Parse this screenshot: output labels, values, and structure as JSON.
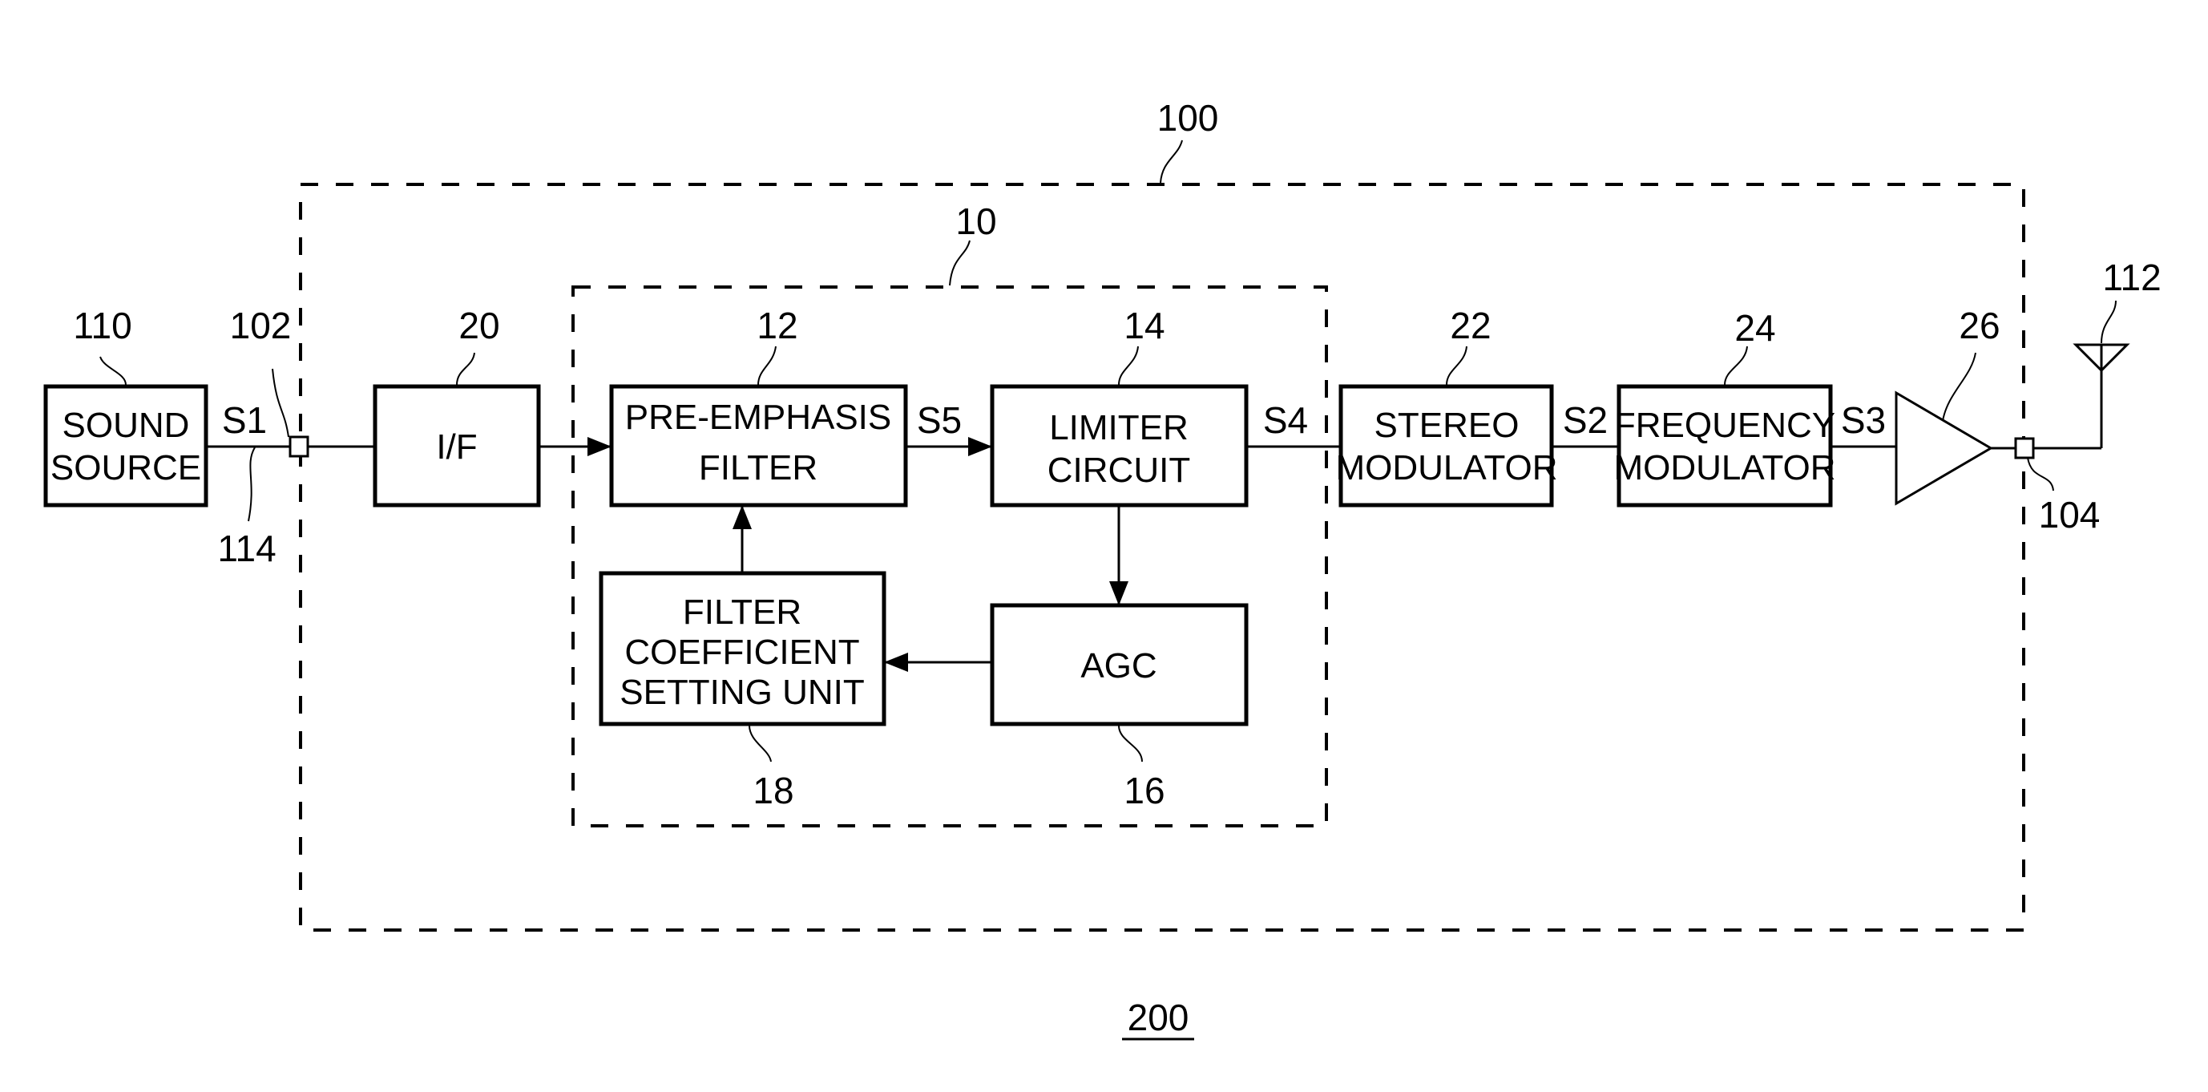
{
  "figure_label": "200",
  "groups": {
    "outer": {
      "ref": "100"
    },
    "inner": {
      "ref": "10"
    }
  },
  "blocks": {
    "sound_source": {
      "ref": "110",
      "lines": [
        "SOUND",
        "SOURCE"
      ]
    },
    "interface": {
      "ref": "20",
      "lines": [
        "I/F"
      ]
    },
    "pre_emphasis": {
      "ref": "12",
      "lines": [
        "PRE-EMPHASIS",
        "FILTER"
      ]
    },
    "limiter": {
      "ref": "14",
      "lines": [
        "LIMITER",
        "CIRCUIT"
      ]
    },
    "agc": {
      "ref": "16",
      "lines": [
        "AGC"
      ]
    },
    "filter_coeff": {
      "ref": "18",
      "lines": [
        "FILTER",
        "COEFFICIENT",
        "SETTING UNIT"
      ]
    },
    "stereo_mod": {
      "ref": "22",
      "lines": [
        "STEREO",
        "MODULATOR"
      ]
    },
    "freq_mod": {
      "ref": "24",
      "lines": [
        "FREQUENCY",
        "MODULATOR"
      ]
    },
    "amplifier": {
      "ref": "26"
    }
  },
  "terminals": {
    "input": {
      "ref": "102"
    },
    "output": {
      "ref": "104"
    }
  },
  "cable": {
    "ref": "114"
  },
  "antenna": {
    "ref": "112"
  },
  "signals": {
    "s1": "S1",
    "s2": "S2",
    "s3": "S3",
    "s4": "S4",
    "s5": "S5"
  }
}
